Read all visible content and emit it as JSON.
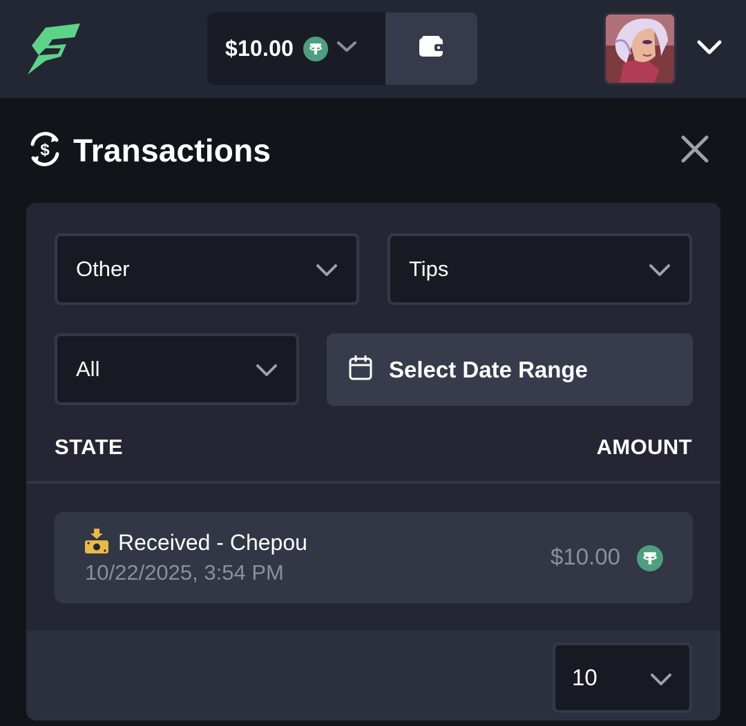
{
  "header": {
    "balance": "$10.00",
    "currency_icon": "tether-icon",
    "wallet_icon": "wallet-icon",
    "logo": "brand-logo"
  },
  "panel": {
    "title": "Transactions",
    "title_icon": "currency-exchange-icon",
    "close_icon": "close-icon"
  },
  "filters": {
    "category": "Other",
    "type": "Tips",
    "status": "All",
    "date_range_label": "Select Date Range",
    "date_icon": "calendar-icon"
  },
  "columns": {
    "state": "STATE",
    "amount": "AMOUNT"
  },
  "transactions": [
    {
      "title": "Received - Chepou",
      "date": "10/22/2025, 3:54 PM",
      "amount": "$10.00",
      "icon": "money-received-icon"
    }
  ],
  "pagination": {
    "page_size": "10"
  },
  "colors": {
    "accent_green": "#4e9f80",
    "logo_green": "#5fd28a",
    "topbar": "#232633",
    "background": "#131419",
    "card": "#242733"
  }
}
